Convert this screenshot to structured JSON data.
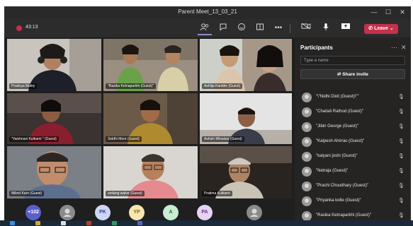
{
  "window": {
    "title": "Parent Meet_13_03_21",
    "minimize": "—",
    "maximize": "☐",
    "close": "✕"
  },
  "toolbar": {
    "timer": "43:13",
    "icons": [
      "people-icon",
      "chat-icon",
      "reactions-icon",
      "rooms-icon",
      "more-icon",
      "camera-icon",
      "mic-icon",
      "share-screen-icon"
    ],
    "leave_label": "Leave",
    "accent": "#c4314b"
  },
  "tiles": [
    {
      "name": "Pradnya Muley"
    },
    {
      "name": "\"Rasika Ketnaparkhi (Guest)\""
    },
    {
      "name": "Ashlija Kamble (Guest)"
    },
    {
      "name": "\"Vaishnavi Kulkarni \" (Guest)"
    },
    {
      "name": "Siddhi More (Guest)"
    },
    {
      "name": "Ashish Mhaskar (Guest)"
    },
    {
      "name": "Milind Karn (Guest)"
    },
    {
      "name": "vedang walve (Guest)"
    },
    {
      "name": "Pratima Kulkarni"
    }
  ],
  "bottom_bubbles": [
    {
      "label": "+102",
      "bg": "#5b5fc7",
      "fg": "#ffffff"
    },
    {
      "label": "",
      "bg": "#8a8a8a",
      "fg": "#ffffff"
    },
    {
      "label": "PK",
      "bg": "#cfd6f5",
      "fg": "#3a3f8f"
    },
    {
      "label": "YP",
      "bg": "#f5e7b0",
      "fg": "#8a6a00"
    },
    {
      "label": "A",
      "bg": "#c9ecd2",
      "fg": "#1f6b35"
    },
    {
      "label": "PA",
      "bg": "#e6d4f2",
      "fg": "#6a2f8a"
    },
    {
      "label": "",
      "bg": "#8a8a8a",
      "fg": "#ffffff"
    }
  ],
  "participants": {
    "title": "Participants",
    "search_placeholder": "Type a name",
    "share_label": "Share invite",
    "list": [
      "\"\\\"Nidhi Dixit (Guest)\\\"\"",
      "\"Chaitali Rathod (Guest)\"",
      "\"Jibin George (Guest)\"",
      "\"Kalpesh Ahirrao (Guest)\"",
      "\"kalyani joshi (Guest)\"",
      "\"Netraja (Guest)\"",
      "\"Prachi Choudhary (Guest)\"",
      "\"Priyanka kolte (Guest)\"",
      "\"Rasika Ketnaparkhi (Guest)\""
    ]
  }
}
